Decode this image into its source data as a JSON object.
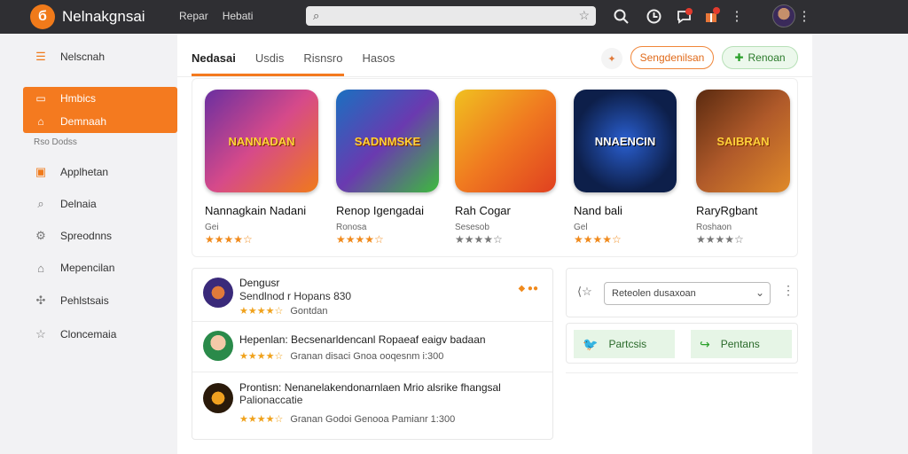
{
  "app": {
    "title": "Nelnakgnsai",
    "logo_letter": "б"
  },
  "topnav": [
    "Repar",
    "Hebati"
  ],
  "search": {
    "placeholder": ""
  },
  "sidebar": {
    "items_top": [
      {
        "label": "Nelscnah",
        "icon": "list-icon"
      }
    ],
    "active": [
      {
        "label": "Hmbics",
        "icon": "store-icon"
      },
      {
        "label": "Demnaah",
        "icon": "bag-icon"
      }
    ],
    "sub_label": "Rso Dodss",
    "items": [
      {
        "label": "Applhetan",
        "icon": "app-icon"
      },
      {
        "label": "Delnaia",
        "icon": "search-icon"
      },
      {
        "label": "Spreodnns",
        "icon": "gear-icon"
      },
      {
        "label": "Mepencilan",
        "icon": "bag-icon"
      },
      {
        "label": "Pehlstsais",
        "icon": "puzzle-icon"
      },
      {
        "label": "Cloncemaia",
        "icon": "star-icon"
      }
    ]
  },
  "tabs": [
    {
      "label": "Nedasai",
      "active": true
    },
    {
      "label": "Usdis",
      "active": false
    },
    {
      "label": "Risnsro",
      "active": false
    },
    {
      "label": "Hasos",
      "active": false
    }
  ],
  "header_buttons": {
    "outline": "Sengdenilsan",
    "green": "Renoan"
  },
  "games": [
    {
      "name": "Nannagkain Nadani",
      "sub": "Gei",
      "stars": "★★★★☆",
      "art_text": "NANNADAN",
      "color1": "#6a2fa0",
      "color2": "#f07a1a"
    },
    {
      "name": "Renop Igengadai",
      "sub": "Ronosa",
      "stars": "★★★★☆",
      "art_text": "SADNMSKE",
      "color1": "#1a70c0",
      "color2": "#3dbb3d"
    },
    {
      "name": "Rah Cogar",
      "sub": "Sesesob",
      "stars": "★★★★☆",
      "art_text": "",
      "color1": "#f0a020",
      "color2": "#e04020"
    },
    {
      "name": "Nand bali",
      "sub": "Gel",
      "stars": "★★★★☆",
      "art_text": "NNAENCIN",
      "color1": "#0d1f4a",
      "color2": "#2a5fd0"
    },
    {
      "name": "RaryRgbant",
      "sub": "Roshaon",
      "stars": "★★★★☆",
      "art_text": "SAIBRAN",
      "color1": "#5a2a10",
      "color2": "#e08a2a"
    }
  ],
  "reviews": [
    {
      "t1": "Dengusr",
      "t2": "Sendlnod r Hopans 830",
      "stars": "★★★★☆",
      "meta": "Gontdan",
      "av1": "#3a2a7a",
      "av2": "#e07a3a"
    },
    {
      "t1": "Hepenlan: Becsenarldencanl Ropaeaf eaigv badaan",
      "t2": "",
      "stars": "★★★★☆",
      "meta": "Granan disaci     Gnoa ooqesnm i:300",
      "av1": "#2a8a4a",
      "av2": "#f4c9a8"
    },
    {
      "t1": "Prontisn: Nenanelakendonarnlaen Mrio alsrike fhangsal",
      "t2": "Palionaccatie",
      "stars": "★★★★☆",
      "meta": "Granan Godoi     Genooa Pamianr 1:300",
      "av1": "#2a1a0a",
      "av2": "#f0a020"
    }
  ],
  "filter": {
    "select_value": "Reteolen dusaxoan"
  },
  "shares": [
    {
      "label": "Partcsis",
      "icon": "bird-icon"
    },
    {
      "label": "Pentans",
      "icon": "share-icon"
    }
  ]
}
